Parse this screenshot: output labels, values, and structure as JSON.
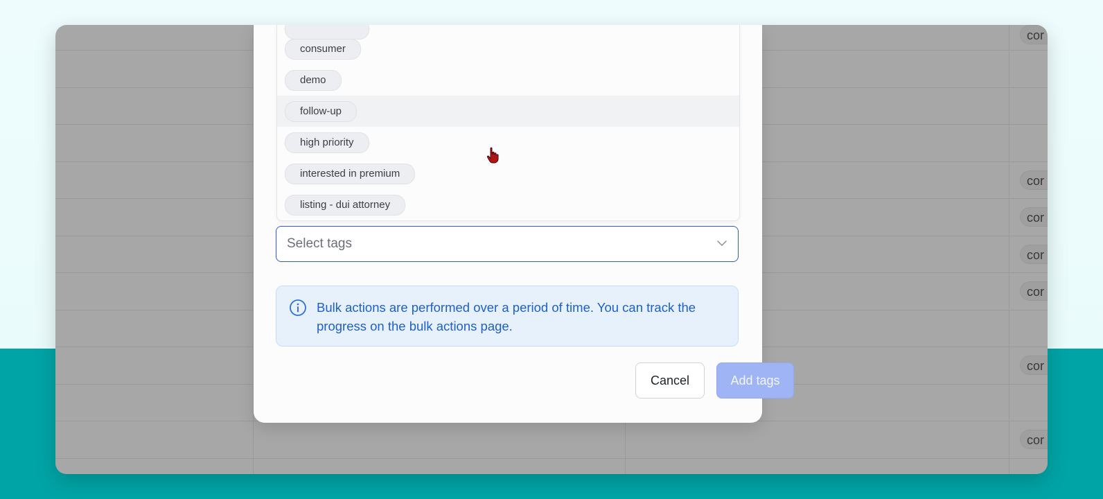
{
  "dialog": {
    "tag_options": [
      {
        "label": "consumer",
        "hovered": false
      },
      {
        "label": "demo",
        "hovered": false
      },
      {
        "label": "follow-up",
        "hovered": true
      },
      {
        "label": "high priority",
        "hovered": false
      },
      {
        "label": "interested in premium",
        "hovered": false
      },
      {
        "label": "listing - dui attorney",
        "hovered": false
      }
    ],
    "select": {
      "placeholder": "Select tags"
    },
    "info": {
      "message": "Bulk actions are performed over a period of time. You can track the progress on the bulk actions page."
    },
    "buttons": {
      "cancel": "Cancel",
      "add_tags": "Add tags"
    }
  },
  "background_table": {
    "row_chip_text": "cor"
  },
  "colors": {
    "accent": "#2f59d6",
    "info_text": "#1f5fc8",
    "disabled_primary": "#9eb4f5",
    "teal_band": "#00a4a6"
  }
}
